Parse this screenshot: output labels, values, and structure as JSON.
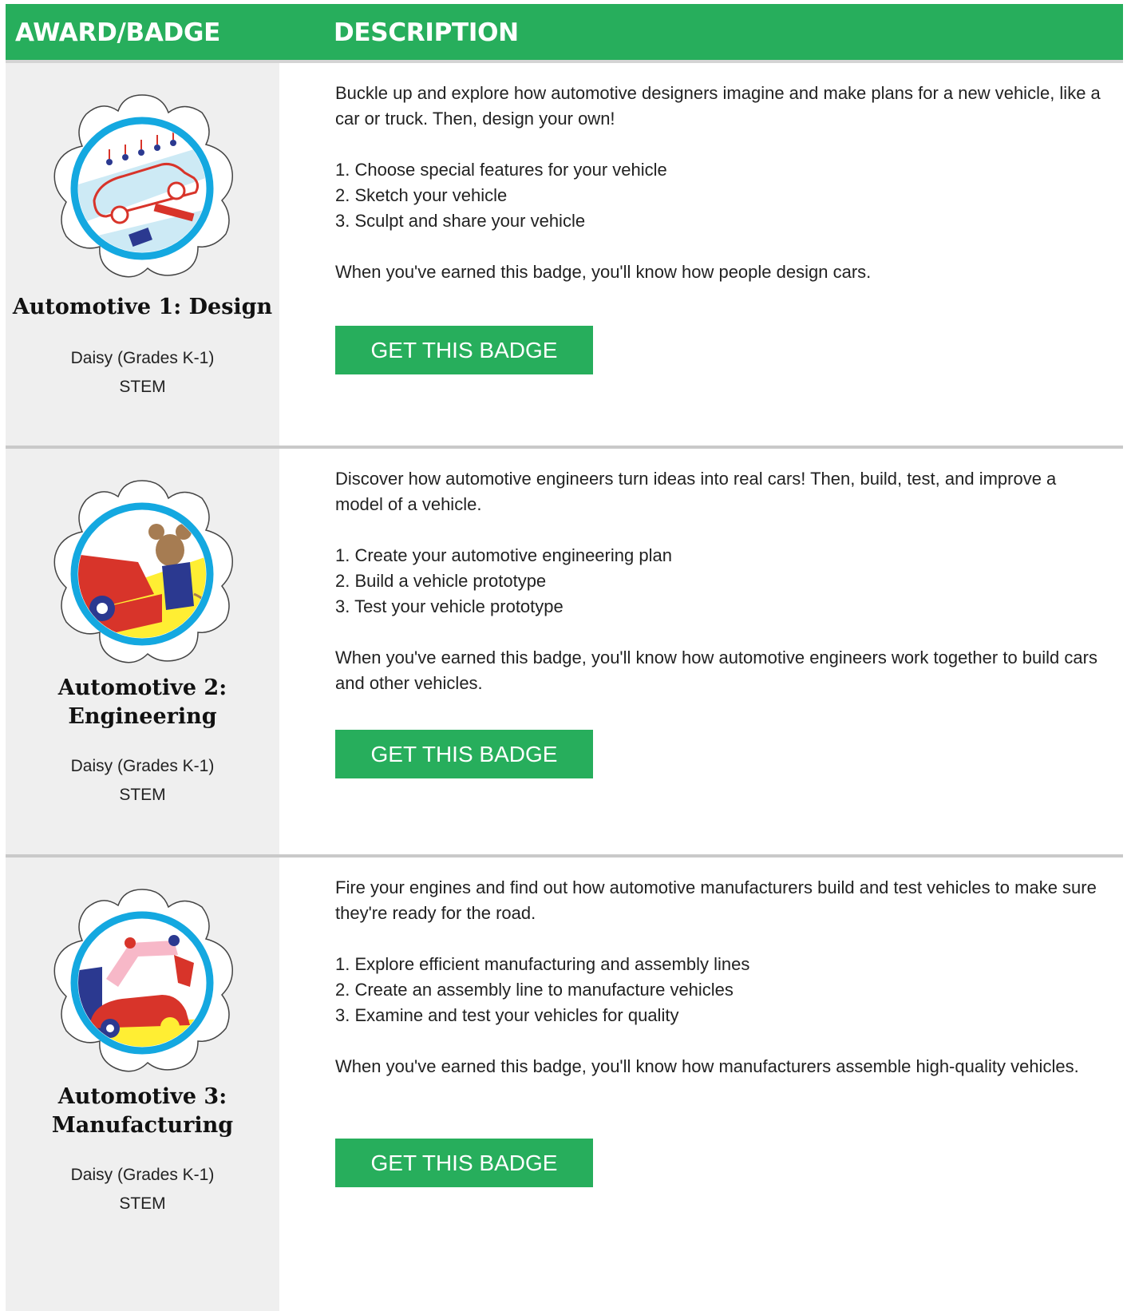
{
  "header": {
    "col1": "AWARD/BADGE",
    "col2": "DESCRIPTION"
  },
  "badges": [
    {
      "name_lines": [
        "Automotive 1: Design"
      ],
      "level": "Daisy (Grades K-1)",
      "category": "STEM",
      "intro": "Buckle up and explore how automotive designers imagine and make plans for a new vehicle, like a car or truck. Then, design your own!",
      "steps": [
        "1. Choose special features for your vehicle",
        "2. Sketch your vehicle",
        "3. Sculpt and share your vehicle"
      ],
      "outcome": "When you've earned this badge, you'll know how people design cars.",
      "button": "GET THIS BADGE"
    },
    {
      "name_lines": [
        "Automotive 2:",
        "Engineering"
      ],
      "level": "Daisy (Grades K-1)",
      "category": "STEM",
      "intro": "Discover how automotive engineers turn ideas into real cars! Then, build, test, and improve a model of a vehicle.",
      "steps": [
        "1. Create your automotive engineering plan",
        "2. Build a vehicle prototype",
        "3. Test your vehicle prototype"
      ],
      "outcome": "When you've earned this badge, you'll know how automotive engineers work together to build cars and other vehicles.",
      "button": "GET THIS BADGE"
    },
    {
      "name_lines": [
        "Automotive 3:",
        "Manufacturing"
      ],
      "level": "Daisy (Grades K-1)",
      "category": "STEM",
      "intro": "Fire your engines and find out how automotive manufacturers build and test vehicles to make sure they're ready for the road.",
      "steps": [
        "1. Explore efficient manufacturing and assembly lines",
        "2. Create an assembly line to manufacture vehicles",
        "3. Examine and test your vehicles for quality"
      ],
      "outcome": "When you've earned this badge, you'll know how manufacturers assemble high-quality vehicles.",
      "button": "GET THIS BADGE"
    }
  ],
  "colors": {
    "brand_green": "#27ae5c",
    "left_column_bg": "#efefef",
    "badge_ring": "#14a8e0"
  },
  "icons": [
    "daisy-design-badge-icon",
    "daisy-engineering-badge-icon",
    "daisy-manufacturing-badge-icon"
  ]
}
